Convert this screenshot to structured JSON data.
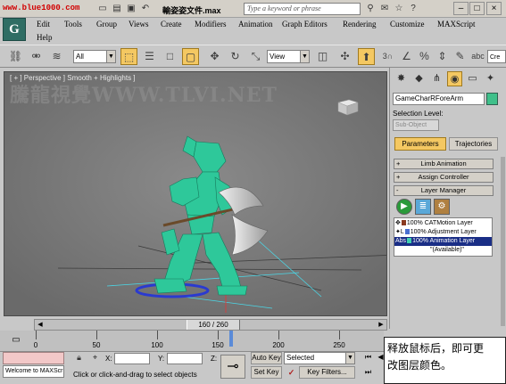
{
  "title_bar": {
    "watermark": "www.blue1000.com",
    "window_title": "輸姿姿文件.max",
    "search_placeholder": "Type a keyword or phrase"
  },
  "app_logo": "G",
  "menu": [
    "Edit",
    "Tools",
    "Group",
    "Views",
    "Create",
    "Modifiers",
    "Animation",
    "Graph Editors",
    "Rendering",
    "Customize",
    "MAXScript",
    "Help"
  ],
  "toolbar": {
    "selection_filter": "All",
    "ref_coord": "View",
    "snap_value": "3"
  },
  "viewport": {
    "label": "[ + ] Perspective ] Smooth + Highlights ]",
    "watermark": "騰龍視覺WWW.TLVI.NET"
  },
  "command_panel": {
    "object_name": "GameCharRForeArm",
    "selection_level_label": "Selection Level:",
    "sub_object_value": "Sub-Object",
    "parameters_button": "Parameters",
    "trajectories_button": "Trajectories",
    "rollouts": [
      {
        "sign": "+",
        "label": "Limb Animation"
      },
      {
        "sign": "+",
        "label": "Assign Controller"
      },
      {
        "sign": "-",
        "label": "Layer Manager"
      }
    ],
    "layers": [
      {
        "prefix": "✥",
        "color": "#8a3a20",
        "text": "100% CATMotion Layer"
      },
      {
        "prefix": "✦L",
        "color": "#4a6fd0",
        "text": "100% Adjustment Layer"
      },
      {
        "prefix": "Abs",
        "color": "#3fd0b0",
        "text": "100% Animation Layer"
      },
      {
        "prefix": "",
        "color": "",
        "text": "\"(Available)\""
      }
    ]
  },
  "timeline": {
    "frame_display": "160 / 260",
    "current_frame": 160,
    "total_frames": 260,
    "ticks": [
      "0",
      "50",
      "100",
      "150",
      "200",
      "250"
    ]
  },
  "status": {
    "welcome": "Welcome to MAXScr",
    "x_label": "X:",
    "y_label": "Y:",
    "z_label": "Z:",
    "prompt": "Click or click-and-drag to select objects",
    "auto_key": "Auto Key",
    "set_key": "Set Key",
    "key_filters": "Key Filters...",
    "selection_set": "Selected"
  },
  "callout": {
    "line1": "释放鼠标后，即可更",
    "line2": "改图层颜色。"
  },
  "colors": {
    "accent_yellow": "#f4c862",
    "selection_blue": "#1a2e86",
    "character_green": "#2ec89a"
  }
}
